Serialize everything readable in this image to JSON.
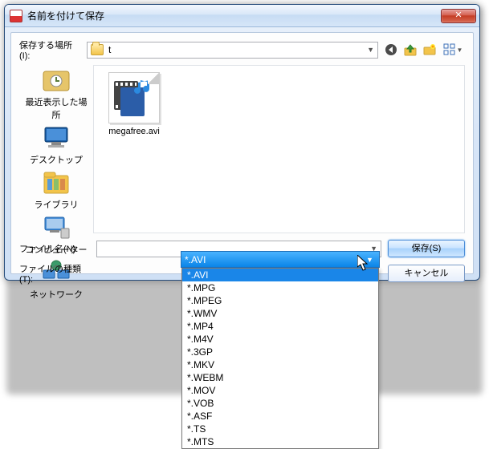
{
  "window": {
    "title": "名前を付けて保存"
  },
  "toprow": {
    "save_in_label": "保存する場所(I):",
    "folder_name": "t"
  },
  "toolbar_icons": {
    "back": "back-icon",
    "up": "up-one-level-icon",
    "newfolder": "new-folder-icon",
    "viewmode": "view-mode-icon"
  },
  "places": [
    "最近表示した場所",
    "デスクトップ",
    "ライブラリ",
    "コンピューター",
    "ネットワーク"
  ],
  "file_pane": {
    "items": [
      {
        "name": "megafree.avi"
      }
    ]
  },
  "bottom_labels": {
    "filename": "ファイル名(N):",
    "filetype": "ファイルの種類(T):"
  },
  "inputs": {
    "filename_value": "",
    "filetype_selected": "*.AVI"
  },
  "buttons": {
    "save": "保存(S)",
    "cancel": "キャンセル"
  },
  "filetype_dropdown": {
    "open": true,
    "selected_index": 0,
    "options": [
      "*.AVI",
      "*.MPG",
      "*.MPEG",
      "*.WMV",
      "*.MP4",
      "*.M4V",
      "*.3GP",
      "*.MKV",
      "*.WEBM",
      "*.MOV",
      "*.VOB",
      "*.ASF",
      "*.TS",
      "*.MTS"
    ]
  },
  "colors": {
    "highlight": "#1a86e8",
    "titlebar_close": "#c33a22"
  }
}
